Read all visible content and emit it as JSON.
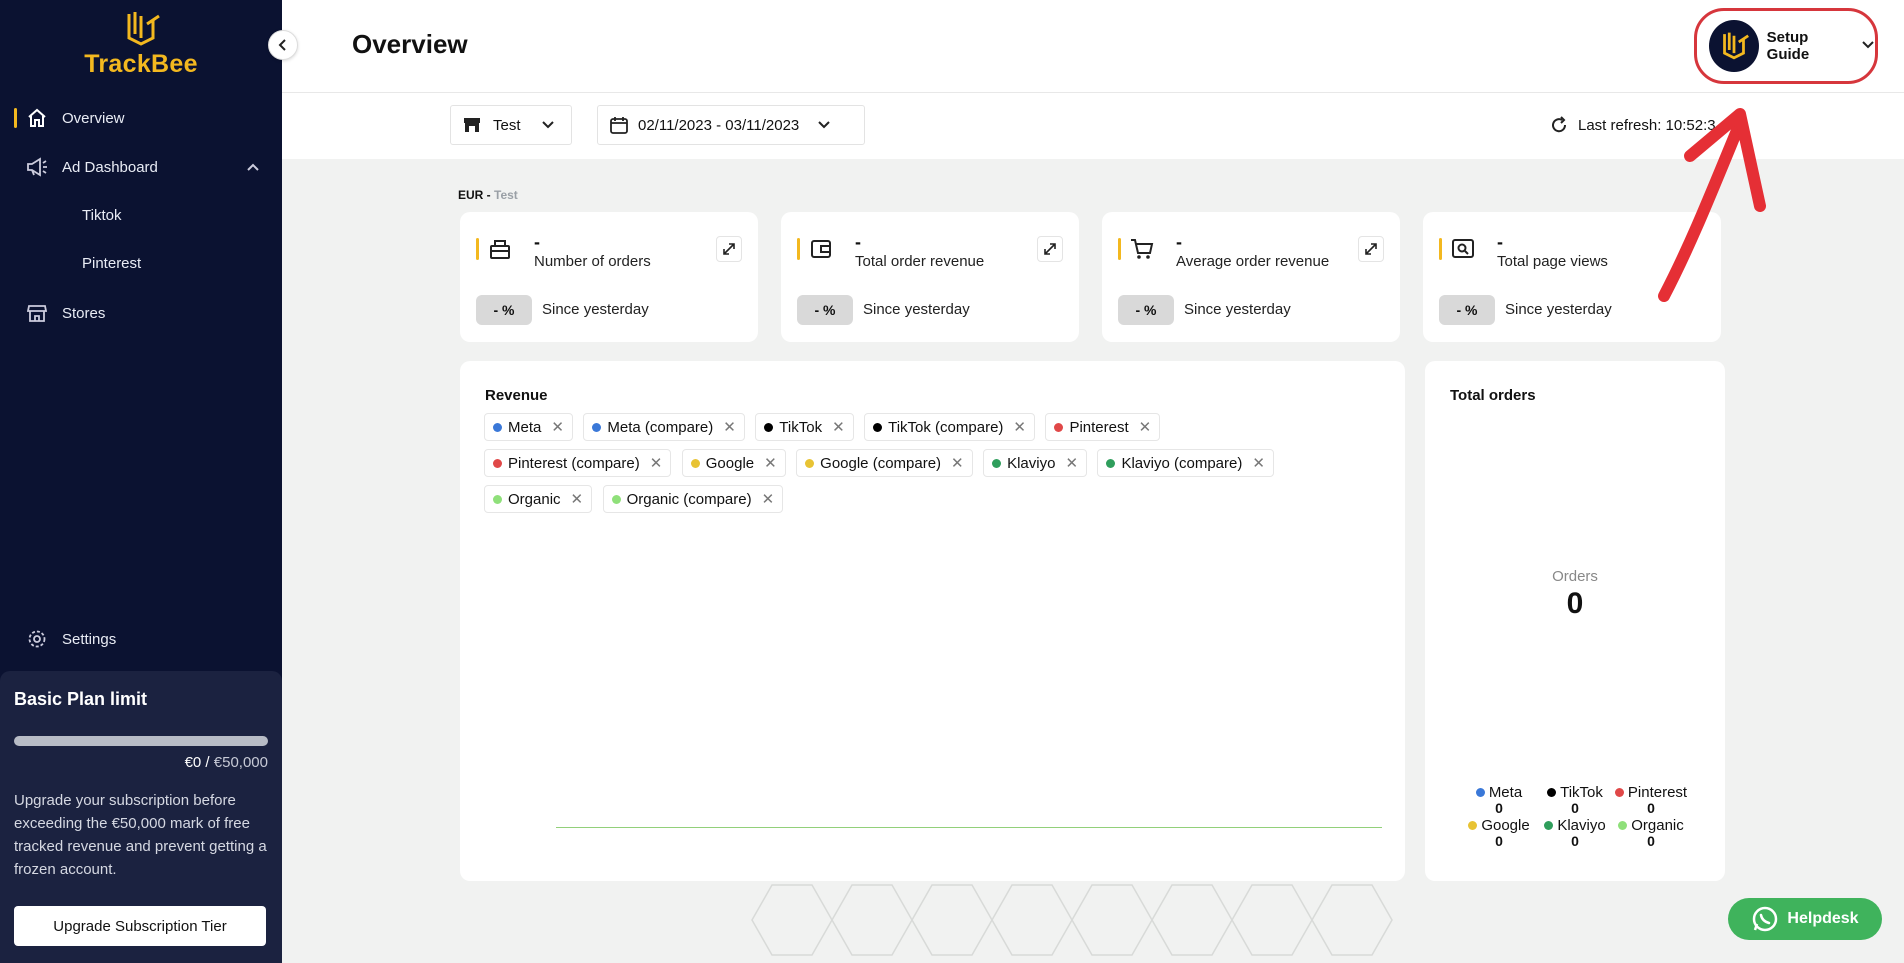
{
  "brand": {
    "name": "TrackBee",
    "accent": "#f3b81f"
  },
  "sidebar": {
    "items": [
      {
        "label": "Overview",
        "icon": "home-icon"
      },
      {
        "label": "Ad Dashboard",
        "icon": "megaphone-icon"
      },
      {
        "label": "Tiktok"
      },
      {
        "label": "Pinterest"
      },
      {
        "label": "Stores",
        "icon": "store-icon"
      },
      {
        "label": "Settings",
        "icon": "gear-icon"
      }
    ],
    "plan": {
      "title": "Basic Plan limit",
      "used": "€0",
      "limit": "€50,000",
      "usage_fraction": 0,
      "description": "Upgrade your subscription before exceeding the €50,000 mark of free tracked revenue and prevent getting a frozen account.",
      "upgrade_label": "Upgrade Subscription Tier"
    }
  },
  "header": {
    "title": "Overview",
    "setup_label": "Setup Guide"
  },
  "filters": {
    "store": "Test",
    "date_range": "02/11/2023 - 03/11/2023",
    "last_refresh": "Last refresh: 10:52:3"
  },
  "currency": {
    "code": "EUR",
    "sep": " - ",
    "store": "Test"
  },
  "kpis": [
    {
      "value": "-",
      "name": "Number of orders",
      "pct": "- %",
      "since": "Since yesterday",
      "icon": "register-icon"
    },
    {
      "value": "-",
      "name": "Total order revenue",
      "pct": "- %",
      "since": "Since yesterday",
      "icon": "wallet-icon"
    },
    {
      "value": "-",
      "name": "Average order revenue",
      "pct": "- %",
      "since": "Since yesterday",
      "icon": "cart-icon"
    },
    {
      "value": "-",
      "name": "Total page views",
      "pct": "- %",
      "since": "Since yesterday",
      "icon": "browser-search-icon"
    }
  ],
  "revenue": {
    "title": "Revenue",
    "chips": [
      {
        "label": "Meta",
        "color": "#3a78d8"
      },
      {
        "label": "Meta (compare)",
        "color": "#3a78d8"
      },
      {
        "label": "TikTok",
        "color": "#000000"
      },
      {
        "label": "TikTok (compare)",
        "color": "#000000"
      },
      {
        "label": "Pinterest",
        "color": "#e04848"
      },
      {
        "label": "Pinterest (compare)",
        "color": "#e04848"
      },
      {
        "label": "Google",
        "color": "#e8c334"
      },
      {
        "label": "Google (compare)",
        "color": "#e8c334"
      },
      {
        "label": "Klaviyo",
        "color": "#2f9e5c"
      },
      {
        "label": "Klaviyo (compare)",
        "color": "#2f9e5c"
      },
      {
        "label": "Organic",
        "color": "#8fe07a"
      },
      {
        "label": "Organic (compare)",
        "color": "#8fe07a"
      }
    ]
  },
  "total_orders": {
    "title": "Total orders",
    "center_label": "Orders",
    "center_value": "0",
    "legend": [
      {
        "label": "Meta",
        "value": "0",
        "color": "#3a78d8"
      },
      {
        "label": "TikTok",
        "value": "0",
        "color": "#000000"
      },
      {
        "label": "Pinterest",
        "value": "0",
        "color": "#e04848"
      },
      {
        "label": "Google",
        "value": "0",
        "color": "#e8c334"
      },
      {
        "label": "Klaviyo",
        "value": "0",
        "color": "#2f9e5c"
      },
      {
        "label": "Organic",
        "value": "0",
        "color": "#8fe07a"
      }
    ]
  },
  "helpdesk": {
    "label": "Helpdesk"
  }
}
